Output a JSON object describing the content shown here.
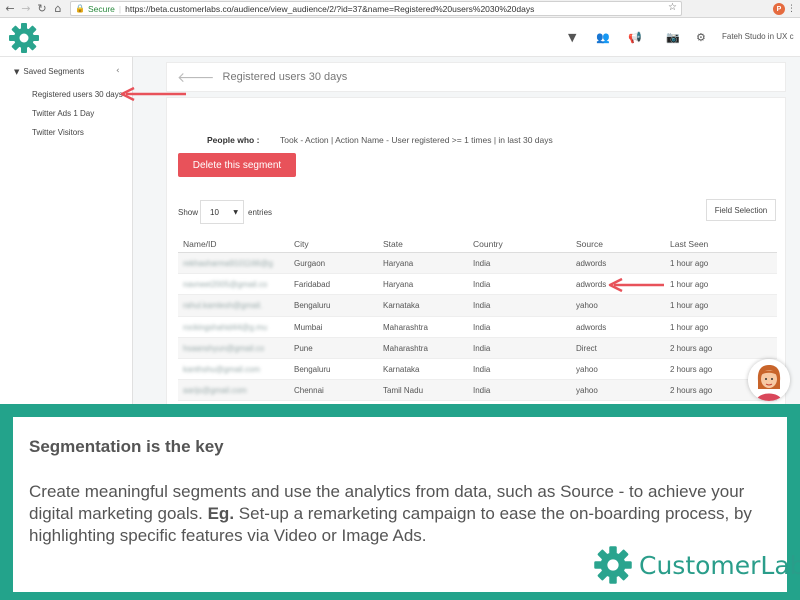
{
  "browser": {
    "secure_label": "Secure",
    "url": "https://beta.customerlabs.co/audience/view_audience/2/?id=37&name=Registered%20users%2030%20days",
    "ext_badge": "P"
  },
  "header": {
    "user_label": "Fateh Studo in UX c"
  },
  "sidebar": {
    "title": "Saved Segments",
    "items": [
      {
        "label": "Registered users 30 days"
      },
      {
        "label": "Twitter Ads 1 Day"
      },
      {
        "label": "Twitter Visitors"
      }
    ]
  },
  "main": {
    "title": "Registered users 30 days",
    "people_label": "People who :",
    "people_value": "Took - Action | Action Name - User registered >= 1 times | in last 30 days",
    "delete_button": "Delete this segment",
    "show_label": "Show",
    "entries_value": "10",
    "entries_label": "entries",
    "field_selection": "Field Selection",
    "table": {
      "columns": [
        "Name/ID",
        "City",
        "State",
        "Country",
        "Source",
        "Last Seen"
      ],
      "rows": [
        {
          "email": "rekhasharma9101166@g",
          "city": "Gurgaon",
          "state": "Haryana",
          "country": "India",
          "source": "adwords",
          "last_seen": "1 hour ago"
        },
        {
          "email": "navneet2005@gmail.co",
          "city": "Faridabad",
          "state": "Haryana",
          "country": "India",
          "source": "adwords",
          "last_seen": "1 hour ago"
        },
        {
          "email": "rahul.kamlesh@gmail.",
          "city": "Bengaluru",
          "state": "Karnataka",
          "country": "India",
          "source": "yahoo",
          "last_seen": "1 hour ago"
        },
        {
          "email": "rockingshahid44@g.mu",
          "city": "Mumbai",
          "state": "Maharashtra",
          "country": "India",
          "source": "adwords",
          "last_seen": "1 hour ago"
        },
        {
          "email": "hsaanshyun@gmail.co",
          "city": "Pune",
          "state": "Maharashtra",
          "country": "India",
          "source": "Direct",
          "last_seen": "2 hours ago"
        },
        {
          "email": "kanthshu@gmail.com",
          "city": "Bengaluru",
          "state": "Karnataka",
          "country": "India",
          "source": "yahoo",
          "last_seen": "2 hours ago"
        },
        {
          "email": "aarijs@gmail.com",
          "city": "Chennai",
          "state": "Tamil Nadu",
          "country": "India",
          "source": "yahoo",
          "last_seen": "2 hours ago"
        }
      ]
    }
  },
  "panel": {
    "heading": "Segmentation is the key",
    "body_1": "Create meaningful segments and use the analytics from data, such as Source - to achieve your digital marketing goals. ",
    "body_bold": "Eg.",
    "body_2": " Set-up a remarketing campaign to ease the on-boarding process, by highlighting specific features via Video or Image Ads.",
    "brand": "CustomerLabs"
  },
  "colors": {
    "brand_teal": "#23a38b",
    "delete_red": "#e8525a",
    "arrow_red": "#e8525a"
  }
}
